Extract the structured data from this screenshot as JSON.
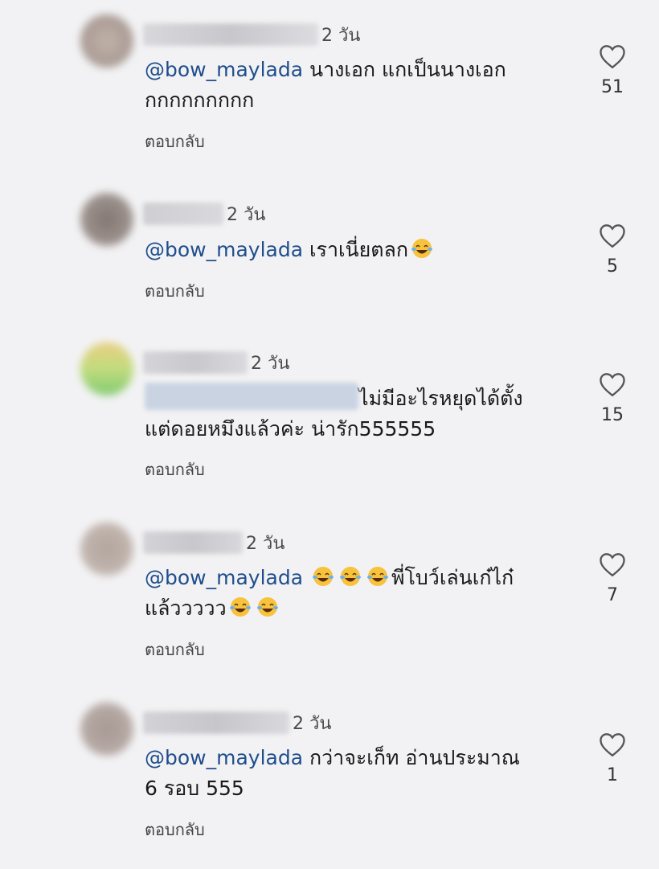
{
  "comments": [
    {
      "age": "2 วัน",
      "mention": "@bow_maylada",
      "text_line1": " นางเอก แกเป็นนางเอก",
      "text_line2": "กกกกกกกกก",
      "reply": "ตอบกลับ",
      "likes": "51"
    },
    {
      "age": "2 วัน",
      "mention": "@bow_maylada",
      "text_line1": " เราเนี่ยตลก",
      "reply": "ตอบกลับ",
      "likes": "5"
    },
    {
      "age": "2 วัน",
      "text_line1": "ไม่มีอะไรหยุดได้ตั้ง",
      "text_line2": "แต่ดอยหมึงแล้วค่ะ น่ารัก555555",
      "reply": "ตอบกลับ",
      "likes": "15"
    },
    {
      "age": "2 วัน",
      "mention": "@bow_maylada",
      "text_line1": "พี่โบว์เล่นเก๋ไก๋",
      "text_line2": "แล้ววววว",
      "reply": "ตอบกลับ",
      "likes": "7"
    },
    {
      "age": "2 วัน",
      "mention": "@bow_maylada",
      "text_line1": " กว่าจะเก็ท อ่านประมาณ",
      "text_line2": "6 รอบ 555",
      "reply": "ตอบกลับ",
      "likes": "1"
    }
  ],
  "colors": {
    "mention": "#1f4e8c",
    "background": "#f2f2f4"
  },
  "icons": {
    "like": "heart-outline-icon",
    "emoji": "face-with-tears-of-joy-icon"
  }
}
